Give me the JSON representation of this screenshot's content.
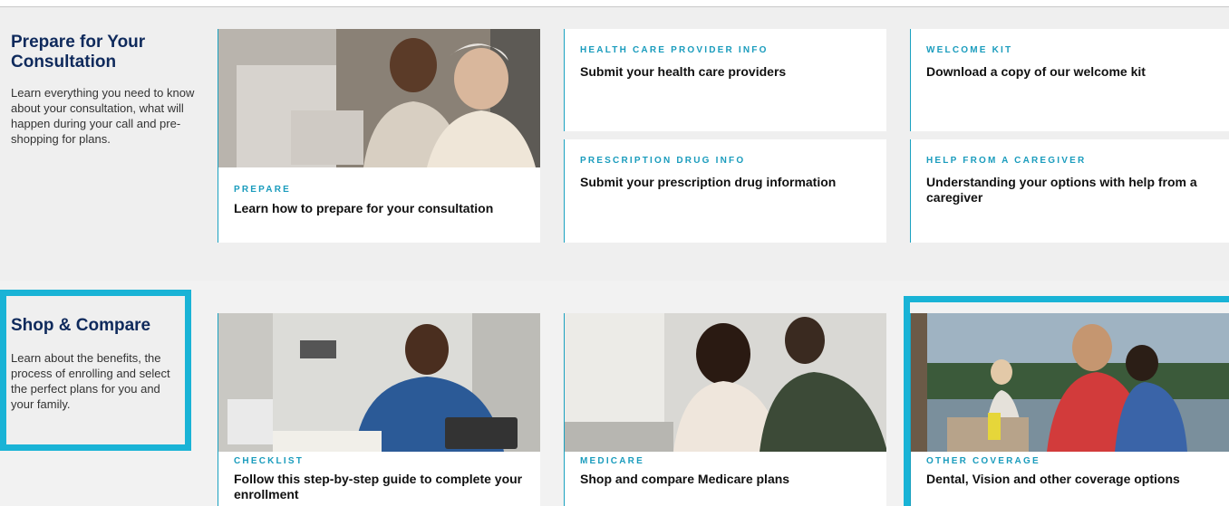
{
  "prepare": {
    "heading": "Prepare for Your Consultation",
    "description": "Learn everything you need to know about your consultation, what will happen during your call and pre-shopping for plans.",
    "cards": {
      "prepare": {
        "eyebrow": "PREPARE",
        "title": "Learn how to prepare for your consultation"
      },
      "provider": {
        "eyebrow": "HEALTH CARE PROVIDER INFO",
        "title": "Submit your health care providers"
      },
      "welcome": {
        "eyebrow": "WELCOME KIT",
        "title": "Download a copy of our welcome kit"
      },
      "drug": {
        "eyebrow": "PRESCRIPTION DRUG INFO",
        "title": "Submit your prescription drug information"
      },
      "caregiver": {
        "eyebrow": "HELP FROM A CAREGIVER",
        "title": "Understanding your options with help from a caregiver"
      }
    }
  },
  "shop": {
    "heading": "Shop & Compare",
    "description": "Learn about the benefits, the process of enrolling and select the perfect plans for you and your family.",
    "cards": {
      "checklist": {
        "eyebrow": "CHECKLIST",
        "title": "Follow this step-by-step guide to complete your enrollment"
      },
      "medicare": {
        "eyebrow": "MEDICARE",
        "title": "Shop and compare Medicare plans"
      },
      "other": {
        "eyebrow": "OTHER COVERAGE",
        "title": "Dental, Vision and other coverage options"
      }
    }
  },
  "colors": {
    "accent": "#19b3d6",
    "heading": "#0f2a5c",
    "eyebrow": "#1a9cbd"
  }
}
